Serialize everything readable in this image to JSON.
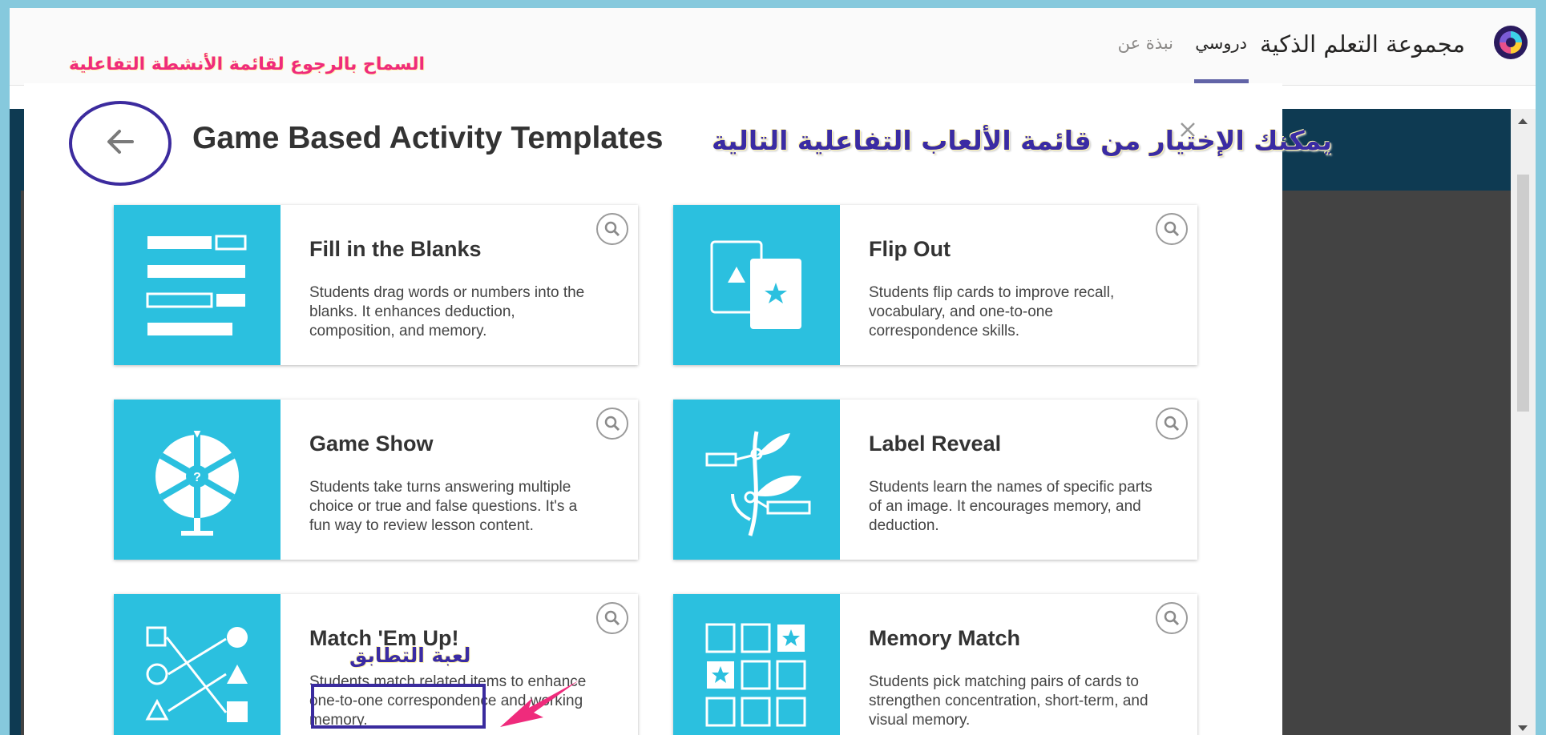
{
  "header": {
    "app_title": "مجموعة التعلم الذكية",
    "tabs": [
      {
        "label": "دروسي",
        "active": true
      },
      {
        "label": "نبذة عن",
        "active": false
      }
    ]
  },
  "annotations": {
    "back_label": "السماح بالرجوع لقائمة الأنشطة التفاعلية",
    "heading": "يمكنك الإختيار من قائمة الألعاب التفاعلية التالية",
    "match_label": "لعبة التطابق"
  },
  "dialog": {
    "title": "Game Based Activity Templates"
  },
  "templates": [
    {
      "title": "Fill in the Blanks",
      "description": "Students drag words or numbers into the blanks. It enhances deduction, composition, and memory.",
      "icon": "fill-blanks-icon"
    },
    {
      "title": "Flip Out",
      "description": "Students flip cards to improve recall, vocabulary, and one-to-one correspondence skills.",
      "icon": "flip-cards-icon"
    },
    {
      "title": "Game Show",
      "description": "Students take turns answering multiple choice or true and false questions. It's a fun way to review lesson content.",
      "icon": "prize-wheel-icon"
    },
    {
      "title": "Label Reveal",
      "description": "Students learn the names of specific parts of an image. It encourages memory, and deduction.",
      "icon": "plant-label-icon"
    },
    {
      "title": "Match 'Em Up!",
      "description": "Students match related items to enhance one-to-one correspondence and working memory.",
      "icon": "shape-match-icon"
    },
    {
      "title": "Memory Match",
      "description": "Students pick matching pairs of cards to strengthen concentration, short-term, and visual memory.",
      "icon": "card-grid-icon"
    }
  ],
  "colors": {
    "accent": "#6264a7",
    "thumb": "#2bc0df",
    "annotation_purple": "#3a2ba4",
    "annotation_pink": "#ef2b7c"
  }
}
